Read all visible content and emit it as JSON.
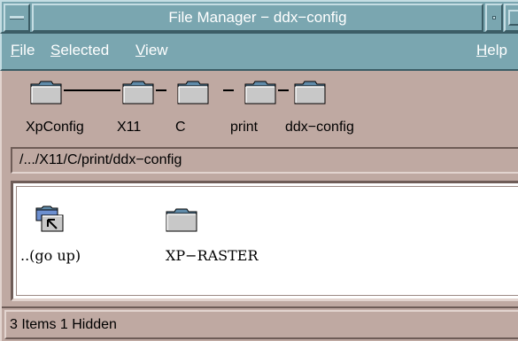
{
  "window": {
    "title": "File Manager − ddx−config"
  },
  "menubar": {
    "items": [
      {
        "mnemonic": "F",
        "rest": "ile"
      },
      {
        "mnemonic": "S",
        "rest": "elected"
      },
      {
        "mnemonic": "V",
        "rest": "iew"
      },
      {
        "mnemonic": "H",
        "rest": "elp"
      }
    ]
  },
  "path_iconbar": {
    "folders": [
      "XpConfig",
      "X11",
      "C",
      "print",
      "ddx−config"
    ]
  },
  "current_path": "/.../X11/C/print/ddx−config",
  "files": [
    {
      "label": "..(go up)",
      "icon": "folder-up-icon"
    },
    {
      "label": "XP−RASTER",
      "icon": "folder-icon"
    }
  ],
  "status": {
    "text": "3 Items 1 Hidden"
  }
}
